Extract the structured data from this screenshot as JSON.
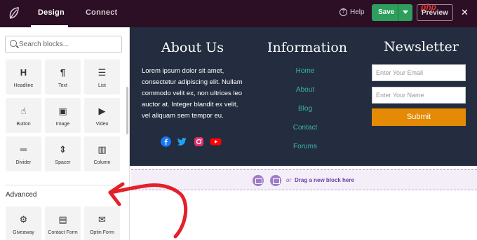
{
  "topbar": {
    "tabs": [
      {
        "label": "Design"
      },
      {
        "label": "Connect"
      }
    ],
    "help_label": "Help",
    "save_label": "Save",
    "preview_label": "Preview",
    "watermark": "php"
  },
  "sidebar": {
    "search_placeholder": "Search blocks...",
    "blocks": [
      {
        "label": "Headline",
        "icon": "H"
      },
      {
        "label": "Text",
        "icon": "¶"
      },
      {
        "label": "List",
        "icon": "☰"
      },
      {
        "label": "Button",
        "icon": "☝"
      },
      {
        "label": "Image",
        "icon": "▣"
      },
      {
        "label": "Video",
        "icon": "▶"
      },
      {
        "label": "Divider",
        "icon": "═"
      },
      {
        "label": "Spacer",
        "icon": "⇕"
      },
      {
        "label": "Column",
        "icon": "▥"
      }
    ],
    "advanced_label": "Advanced",
    "advanced_blocks": [
      {
        "label": "Giveaway",
        "icon": "⚙"
      },
      {
        "label": "Contact Form",
        "icon": "▤"
      },
      {
        "label": "Optin Form",
        "icon": "✉"
      }
    ]
  },
  "canvas": {
    "about": {
      "title": "About Us",
      "text": "Lorem ipsum dolor sit amet, consectetur adipiscing elit. Nullam commodo velit ex, non ultrices leo auctor at. Integer blandit ex velit, vel aliquam sem tempor eu."
    },
    "information": {
      "title": "Information",
      "links": [
        "Home",
        "About",
        "Blog",
        "Contact",
        "Forums"
      ]
    },
    "newsletter": {
      "title": "Newsletter",
      "email_placeholder": "Enter Your Email",
      "name_placeholder": "Enter Your Name",
      "submit_label": "Submit"
    },
    "social_colors": {
      "facebook": "#1877f2",
      "twitter": "#1da1f2",
      "instagram": "#e1306c",
      "youtube": "#ff0000"
    },
    "dropzone": {
      "or_label": "or",
      "text": "Drag a new block here"
    }
  },
  "colors": {
    "topbar": "#2c0f24",
    "save": "#2e9e5c",
    "footer": "#232d3f",
    "link": "#3ab5b0",
    "submit": "#e48a05",
    "arrow": "#e4202a"
  }
}
